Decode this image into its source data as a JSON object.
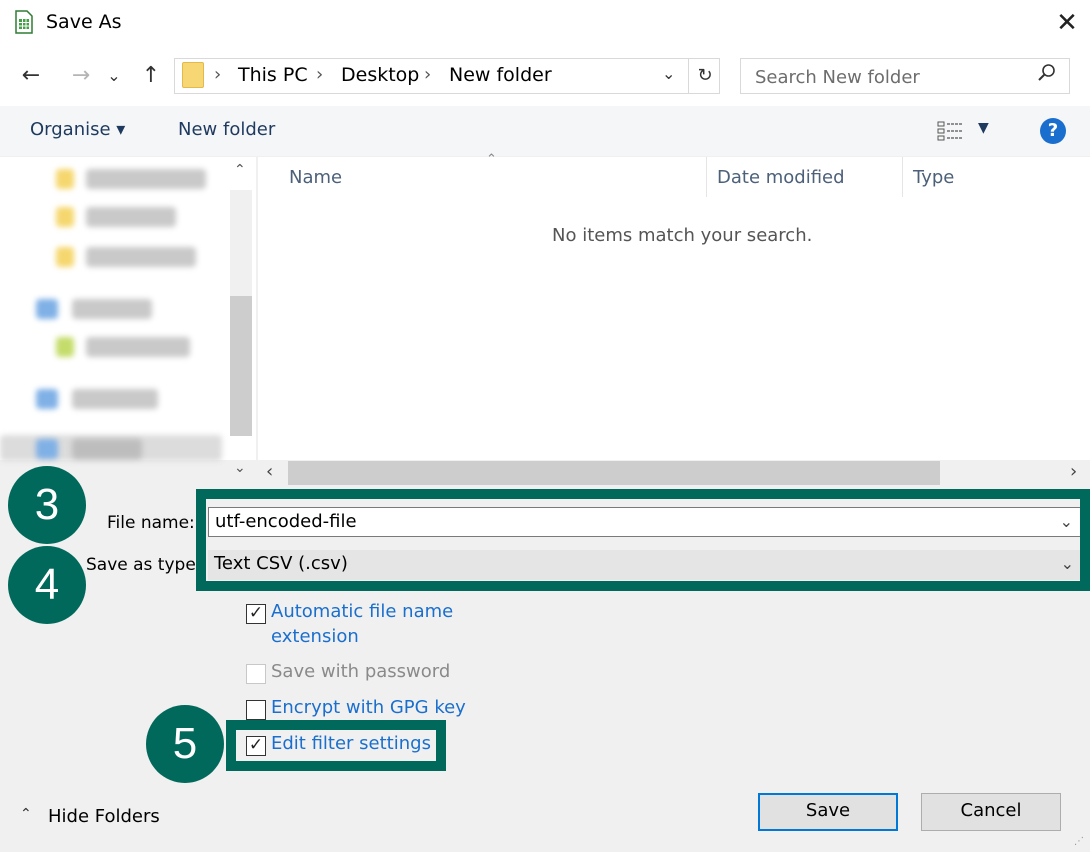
{
  "window": {
    "title": "Save As",
    "close_glyph": "✕"
  },
  "nav": {
    "back": "←",
    "forward": "→",
    "recent": "⌄",
    "up": "↑",
    "refresh": "↻",
    "address_chevron": "⌄",
    "sep": "›"
  },
  "breadcrumb": [
    "This PC",
    "Desktop",
    "New folder"
  ],
  "search": {
    "placeholder": "Search New folder",
    "icon": "search-icon"
  },
  "toolbar": {
    "organise": "Organise ▾",
    "new_folder": "New folder",
    "help": "?"
  },
  "list": {
    "columns": [
      "Name",
      "Date modified",
      "Type"
    ],
    "empty_message": "No items match your search."
  },
  "fields": {
    "file_name_label": "File name:",
    "file_name_value": "utf-encoded-file",
    "save_type_label": "Save as type:",
    "save_type_value": "Text CSV (.csv)"
  },
  "options": {
    "auto_ext_line1": "Automatic file name",
    "auto_ext_line2": "extension",
    "save_password": "Save with password",
    "encrypt_gpg": "Encrypt with GPG key",
    "edit_filter": "Edit filter settings",
    "check": "✓"
  },
  "callouts": [
    "3",
    "4",
    "5"
  ],
  "buttons": {
    "save": "Save",
    "cancel": "Cancel",
    "hide_folders": "Hide Folders"
  },
  "colors": {
    "callout": "#00695c",
    "link": "#1a6fce",
    "primary_border": "#0078d7"
  }
}
